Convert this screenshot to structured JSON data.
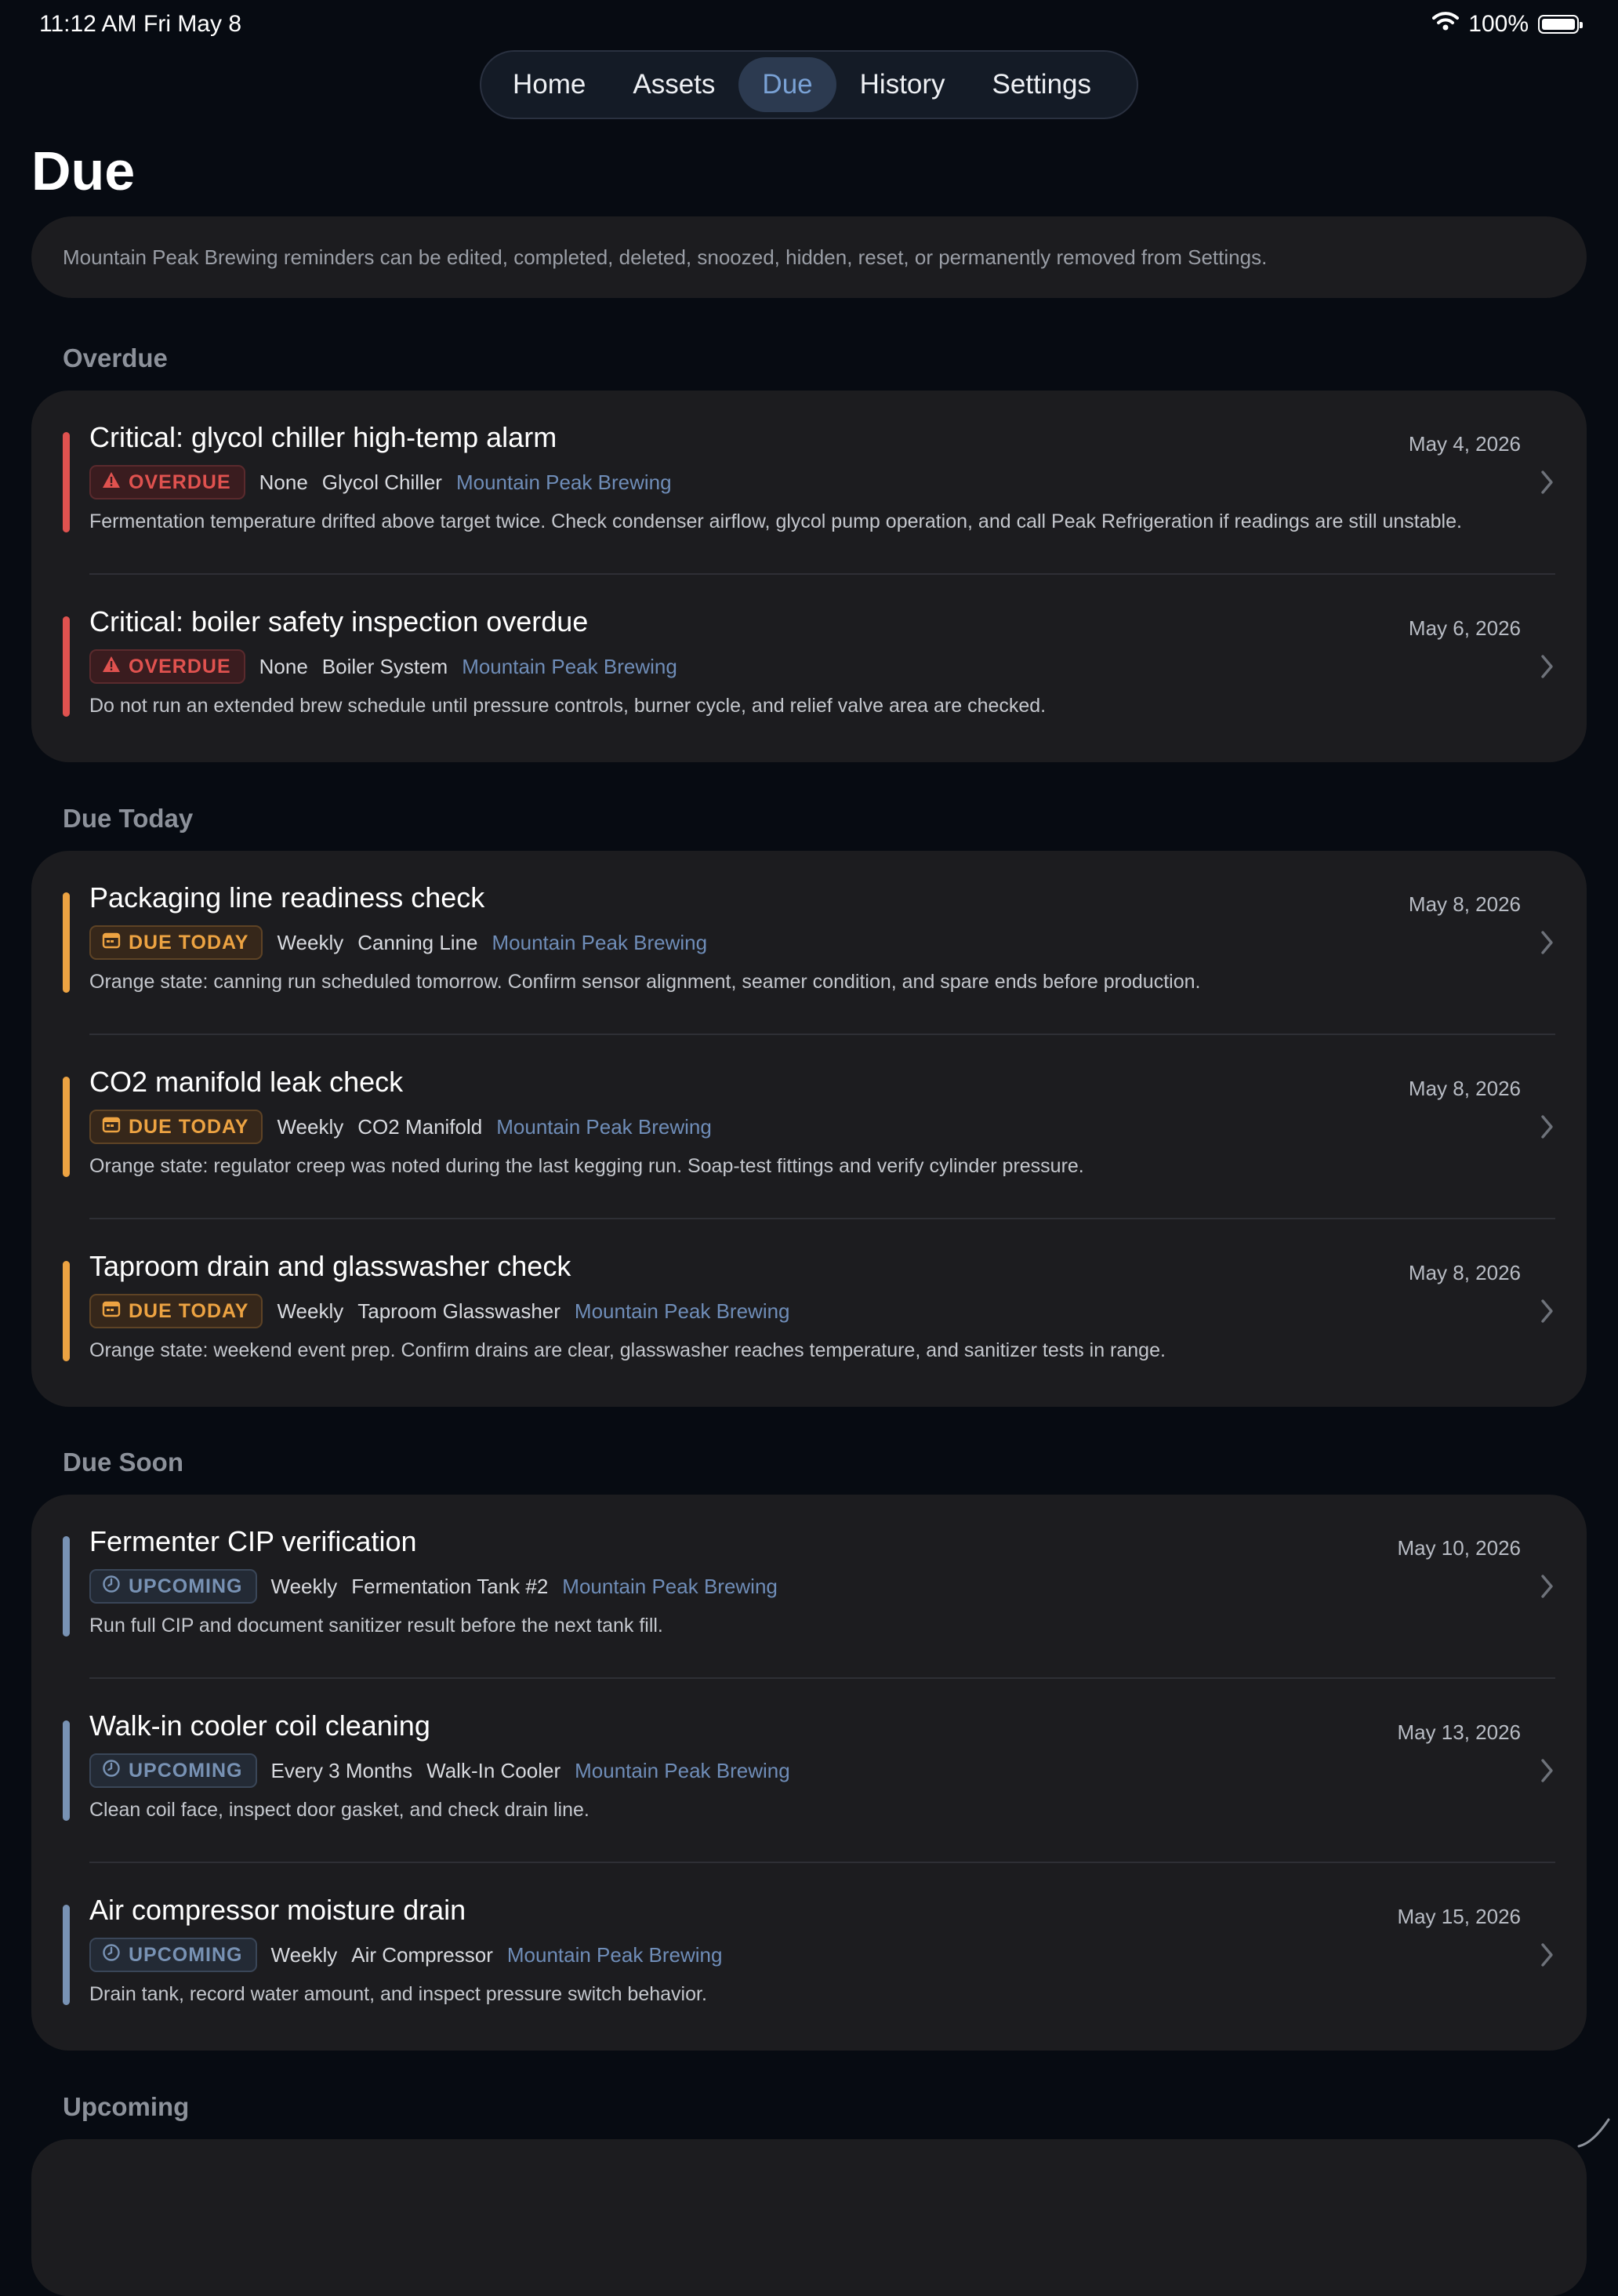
{
  "status_bar": {
    "time": "11:12 AM",
    "date": "Fri May 8",
    "battery": "100%",
    "battery_level": 1.0
  },
  "tabs": [
    {
      "label": "Home",
      "active": false
    },
    {
      "label": "Assets",
      "active": false
    },
    {
      "label": "Due",
      "active": true
    },
    {
      "label": "History",
      "active": false
    },
    {
      "label": "Settings",
      "active": false
    }
  ],
  "page": {
    "title": "Due",
    "banner": "Mountain Peak Brewing reminders can be edited, completed, deleted, snoozed, hidden, reset, or permanently removed from Settings."
  },
  "colors": {
    "overdue": "#e0524f",
    "due_today": "#eda342",
    "upcoming": "#7892b4",
    "org_link": "#6f8db8"
  },
  "sections": [
    {
      "title": "Overdue",
      "items": [
        {
          "title": "Critical: glycol chiller high-temp alarm",
          "date": "May 4, 2026",
          "badge": "OVERDUE",
          "badge_icon": "warning-icon",
          "frequency": "None",
          "asset": "Glycol Chiller",
          "org": "Mountain Peak Brewing",
          "description": "Fermentation temperature drifted above target twice. Check condenser airflow, glycol pump operation, and call Peak Refrigeration if readings are still unstable."
        },
        {
          "title": "Critical: boiler safety inspection overdue",
          "date": "May 6, 2026",
          "badge": "OVERDUE",
          "badge_icon": "warning-icon",
          "frequency": "None",
          "asset": "Boiler System",
          "org": "Mountain Peak Brewing",
          "description": "Do not run an extended brew schedule until pressure controls, burner cycle, and relief valve area are checked."
        }
      ]
    },
    {
      "title": "Due Today",
      "items": [
        {
          "title": "Packaging line readiness check",
          "date": "May 8, 2026",
          "badge": "DUE TODAY",
          "badge_icon": "calendar-icon",
          "frequency": "Weekly",
          "asset": "Canning Line",
          "org": "Mountain Peak Brewing",
          "description": "Orange state: canning run scheduled tomorrow. Confirm sensor alignment, seamer condition, and spare ends before production."
        },
        {
          "title": "CO2 manifold leak check",
          "date": "May 8, 2026",
          "badge": "DUE TODAY",
          "badge_icon": "calendar-icon",
          "frequency": "Weekly",
          "asset": "CO2 Manifold",
          "org": "Mountain Peak Brewing",
          "description": "Orange state: regulator creep was noted during the last kegging run. Soap-test fittings and verify cylinder pressure."
        },
        {
          "title": "Taproom drain and glasswasher check",
          "date": "May 8, 2026",
          "badge": "DUE TODAY",
          "badge_icon": "calendar-icon",
          "frequency": "Weekly",
          "asset": "Taproom Glasswasher",
          "org": "Mountain Peak Brewing",
          "description": "Orange state: weekend event prep. Confirm drains are clear, glasswasher reaches temperature, and sanitizer tests in range."
        }
      ]
    },
    {
      "title": "Due Soon",
      "items": [
        {
          "title": "Fermenter CIP verification",
          "date": "May 10, 2026",
          "badge": "UPCOMING",
          "badge_icon": "clock-icon",
          "frequency": "Weekly",
          "asset": "Fermentation Tank #2",
          "org": "Mountain Peak Brewing",
          "description": "Run full CIP and document sanitizer result before the next tank fill."
        },
        {
          "title": "Walk-in cooler coil cleaning",
          "date": "May 13, 2026",
          "badge": "UPCOMING",
          "badge_icon": "clock-icon",
          "frequency": "Every 3 Months",
          "asset": "Walk-In Cooler",
          "org": "Mountain Peak Brewing",
          "description": "Clean coil face, inspect door gasket, and check drain line."
        },
        {
          "title": "Air compressor moisture drain",
          "date": "May 15, 2026",
          "badge": "UPCOMING",
          "badge_icon": "clock-icon",
          "frequency": "Weekly",
          "asset": "Air Compressor",
          "org": "Mountain Peak Brewing",
          "description": "Drain tank, record water amount, and inspect pressure switch behavior."
        }
      ]
    },
    {
      "title": "Upcoming",
      "items": []
    }
  ]
}
